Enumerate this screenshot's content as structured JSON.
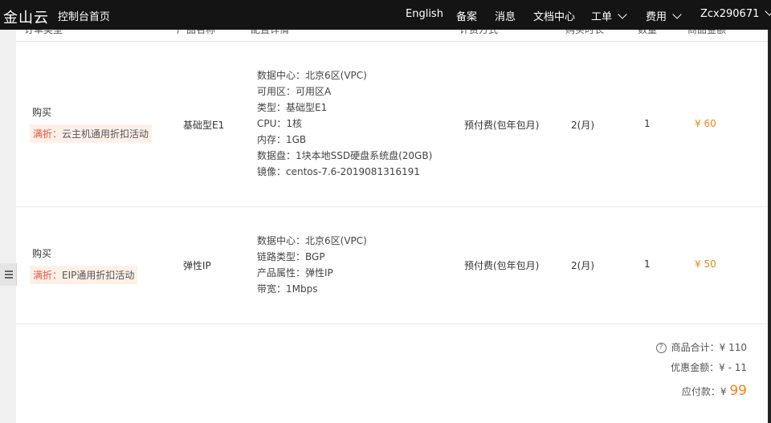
{
  "topbar": {
    "logo": "金山云",
    "home": "控制台首页",
    "nav": {
      "english": "English",
      "beian": "备案",
      "messages": "消息",
      "docs": "文档中心",
      "ticket": "工单",
      "billing": "费用",
      "user": "Zcx290671"
    }
  },
  "table": {
    "headers": [
      "订单类型",
      "产品名称",
      "配置详情",
      "计费方式",
      "购买时长",
      "数量",
      "商品金额"
    ],
    "rows": [
      {
        "type": "购买",
        "promo_tag": "满折：",
        "promo_text": "云主机通用折扣活动",
        "product": "基础型E1",
        "details": [
          "数据中心：北京6区(VPC)",
          "可用区：可用区A",
          "类型：基础型E1",
          "CPU：1核",
          "内存：1GB",
          "数据盘：1块本地SSD硬盘系统盘(20GB)",
          "镜像：centos-7.6-2019081316191"
        ],
        "billing": "预付费(包年包月)",
        "duration": "2(月)",
        "qty": "1",
        "amount": "¥ 60"
      },
      {
        "type": "购买",
        "promo_tag": "满折：",
        "promo_text": "EIP通用折扣活动",
        "product": "弹性IP",
        "details": [
          "数据中心：北京6区(VPC)",
          "链路类型：BGP",
          "产品属性：弹性IP",
          "带宽：1Mbps"
        ],
        "billing": "预付费(包年包月)",
        "duration": "2(月)",
        "qty": "1",
        "amount": "¥ 50"
      }
    ]
  },
  "summary": {
    "help_icon": "?",
    "subtotal": "商品合计：¥ 110",
    "discount": "优惠金额：¥ - 11",
    "payable_label": "应付款：¥",
    "payable_value": "99"
  },
  "colors": {
    "accent": "#f08519",
    "promo_red": "#e8523f",
    "topbar": "#141414"
  }
}
